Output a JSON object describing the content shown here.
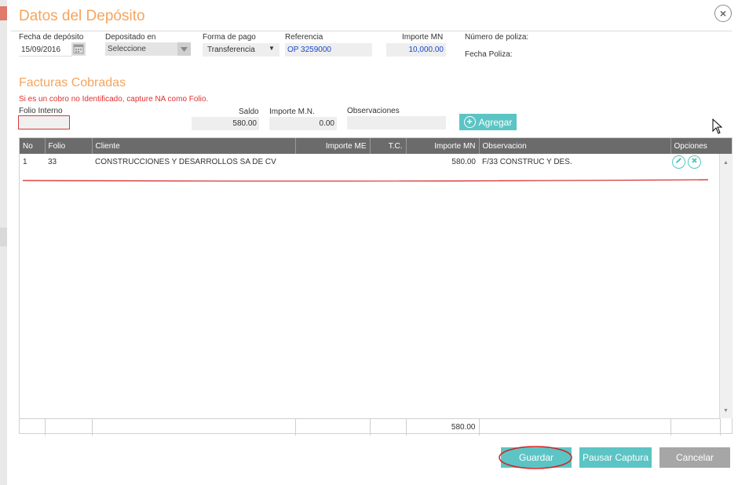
{
  "dialog": {
    "title": "Datos del Depósito",
    "close_symbol": "×"
  },
  "deposit": {
    "fecha_label": "Fecha de depósito",
    "fecha_value": "15/09/2016",
    "depositado_label": "Depositado en",
    "depositado_value": "Seleccione",
    "forma_label": "Forma de pago",
    "forma_value": "Transferencia",
    "referencia_label": "Referencia",
    "referencia_value": "OP 3259000",
    "importe_label": "Importe MN",
    "importe_value": "10,000.00",
    "poliza_label": "Número de poliza:",
    "fecha_poliza_label": "Fecha Poliza:"
  },
  "facturas": {
    "title": "Facturas Cobradas",
    "warning": "Si es un cobro no Identificado, capture NA como Folio.",
    "folio_label": "Folio Interno",
    "folio_value": "",
    "saldo_label": "Saldo",
    "saldo_value": "580.00",
    "importe_mn_label": "Importe M.N.",
    "importe_mn_value": "0.00",
    "observaciones_label": "Observaciones",
    "observaciones_value": "",
    "agregar_label": "Agregar"
  },
  "table": {
    "headers": {
      "no": "No",
      "folio": "Folio",
      "cliente": "Cliente",
      "importe_me": "Importe ME",
      "tc": "T.C.",
      "importe_mn": "Importe MN",
      "observacion": "Observacion",
      "opciones": "Opciones"
    },
    "rows": [
      {
        "no": "1",
        "folio": "33",
        "cliente": "CONSTRUCCIONES Y DESARROLLOS SA DE CV",
        "importe_me": "",
        "tc": "",
        "importe_mn": "580.00",
        "observacion": "F/33 CONSTRUC Y DES."
      }
    ],
    "footer_total": "580.00"
  },
  "actions": {
    "guardar": "Guardar",
    "pausar": "Pausar Captura",
    "cancelar": "Cancelar"
  },
  "colors": {
    "accent_orange": "#f5a55d",
    "teal": "#5cc4c4",
    "header_gray": "#6b6b6b",
    "annotation_red": "#d42020"
  }
}
